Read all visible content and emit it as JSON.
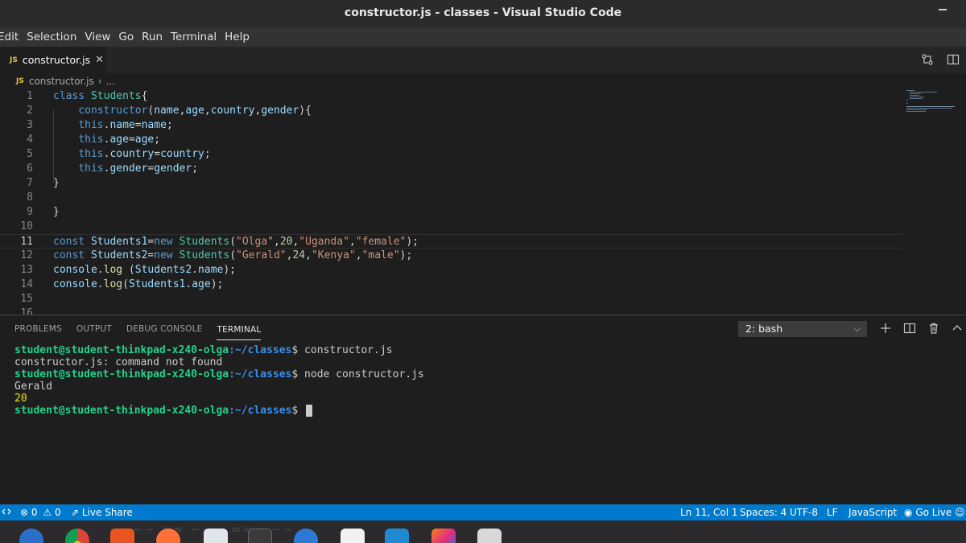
{
  "window": {
    "title": "constructor.js - classes - Visual Studio Code"
  },
  "menu": [
    "Edit",
    "Selection",
    "View",
    "Go",
    "Run",
    "Terminal",
    "Help"
  ],
  "tab": {
    "icon": "JS",
    "label": "constructor.js",
    "close": "✕"
  },
  "breadcrumb": {
    "icon": "JS",
    "file": "constructor.js",
    "sep": "›",
    "rest": "..."
  },
  "editor": {
    "active_line": 11,
    "lines": [
      {
        "n": "1",
        "code": "class Students{"
      },
      {
        "n": "2",
        "code": "    constructor(name,age,country,gender){"
      },
      {
        "n": "3",
        "code": "    this.name=name;"
      },
      {
        "n": "4",
        "code": "    this.age=age;"
      },
      {
        "n": "5",
        "code": "    this.country=country;"
      },
      {
        "n": "6",
        "code": "    this.gender=gender;"
      },
      {
        "n": "7",
        "code": "}"
      },
      {
        "n": "8",
        "code": ""
      },
      {
        "n": "9",
        "code": "}"
      },
      {
        "n": "10",
        "code": ""
      },
      {
        "n": "11",
        "code": "const Students1=new Students(\"Olga\",20,\"Uganda\",\"female\");"
      },
      {
        "n": "12",
        "code": "const Students2=new Students(\"Gerald\",24,\"Kenya\",\"male\");"
      },
      {
        "n": "13",
        "code": "console.log (Students2.name);"
      },
      {
        "n": "14",
        "code": "console.log(Students1.age);"
      },
      {
        "n": "15",
        "code": ""
      },
      {
        "n": "16",
        "code": ""
      }
    ]
  },
  "panel": {
    "tabs": [
      "PROBLEMS",
      "OUTPUT",
      "DEBUG CONSOLE",
      "TERMINAL"
    ],
    "active_tab": "TERMINAL",
    "terminal_select": "2: bash",
    "prompt_user": "student@student-thinkpad-x240-olga",
    "prompt_path": ":~/classes",
    "terminal_lines": [
      {
        "type": "prompt",
        "cmd": " constructor.js"
      },
      {
        "type": "out",
        "text": "constructor.js: command not found"
      },
      {
        "type": "prompt",
        "cmd": " node constructor.js"
      },
      {
        "type": "out",
        "text": "Gerald"
      },
      {
        "type": "out-yellow",
        "text": "20"
      },
      {
        "type": "prompt",
        "cmd": " "
      }
    ]
  },
  "statusbar": {
    "errors": "0",
    "warnings": "0",
    "live_share": "Live Share",
    "position": "Ln 11, Col 1",
    "spaces": "Spaces: 4",
    "encoding": "UTF-8",
    "eol": "LF",
    "language": "JavaScript",
    "go_live": "Go Live"
  },
  "colors": {
    "accent": "#007acc",
    "editor_bg": "#1e1e1e",
    "keyword": "#569cd6",
    "class": "#4ec9b0",
    "string": "#ce9178",
    "number": "#b5cea8",
    "prompt_user": "#23d18b",
    "prompt_path": "#3b8eea"
  }
}
